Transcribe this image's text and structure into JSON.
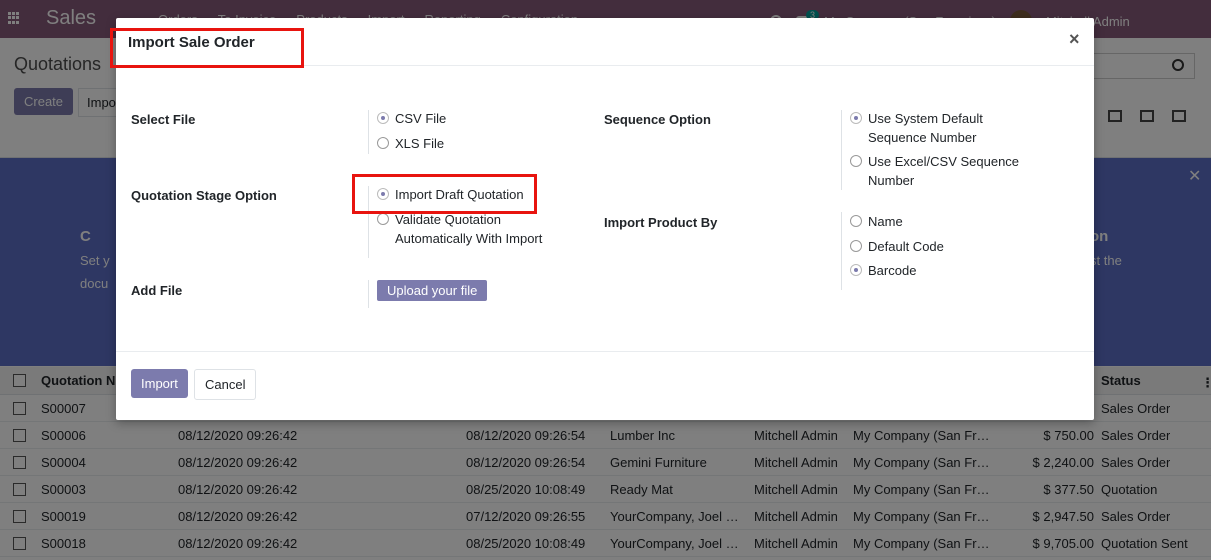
{
  "app": {
    "name": "Sales",
    "menu": [
      "Orders",
      "To Invoice",
      "Products",
      "Import",
      "Reporting",
      "Configuration"
    ],
    "chat_count": "3",
    "company": "My Company (San Francisco)",
    "user": "Mitchell Admin"
  },
  "control": {
    "breadcrumb": "Quotations",
    "create_label": "Create",
    "import_label": "Impo"
  },
  "helper": {
    "left_title": "C",
    "left_desc1": "Set y",
    "left_desc2": "docu",
    "right_title": "on",
    "right_desc": "st the"
  },
  "table": {
    "headers": {
      "number": "Quotation N",
      "status": "Status"
    },
    "rows": [
      {
        "number": "S00007",
        "date": "",
        "expected": "",
        "customer": "",
        "salesperson": "",
        "company": "",
        "total": "",
        "status": "Sales Order"
      },
      {
        "number": "S00006",
        "date": "08/12/2020 09:26:42",
        "expected": "08/12/2020 09:26:54",
        "customer": "Lumber Inc",
        "salesperson": "Mitchell Admin",
        "company": "My Company (San Fr…",
        "total": "$ 750.00",
        "status": "Sales Order"
      },
      {
        "number": "S00004",
        "date": "08/12/2020 09:26:42",
        "expected": "08/12/2020 09:26:54",
        "customer": "Gemini Furniture",
        "salesperson": "Mitchell Admin",
        "company": "My Company (San Fr…",
        "total": "$ 2,240.00",
        "status": "Sales Order"
      },
      {
        "number": "S00003",
        "date": "08/12/2020 09:26:42",
        "expected": "08/25/2020 10:08:49",
        "customer": "Ready Mat",
        "salesperson": "Mitchell Admin",
        "company": "My Company (San Fr…",
        "total": "$ 377.50",
        "status": "Quotation"
      },
      {
        "number": "S00019",
        "date": "08/12/2020 09:26:42",
        "expected": "07/12/2020 09:26:55",
        "customer": "YourCompany, Joel …",
        "salesperson": "Mitchell Admin",
        "company": "My Company (San Fr…",
        "total": "$ 2,947.50",
        "status": "Sales Order"
      },
      {
        "number": "S00018",
        "date": "08/12/2020 09:26:42",
        "expected": "08/25/2020 10:08:49",
        "customer": "YourCompany, Joel …",
        "salesperson": "Mitchell Admin",
        "company": "My Company (San Fr…",
        "total": "$ 9,705.00",
        "status": "Quotation Sent"
      }
    ]
  },
  "modal": {
    "title": "Import Sale Order",
    "close": "×",
    "select_file": {
      "label": "Select File",
      "options": [
        "CSV File",
        "XLS File"
      ],
      "selected": 0
    },
    "stage_option": {
      "label": "Quotation Stage Option",
      "options": [
        "Import Draft Quotation",
        "Validate Quotation Automatically With Import"
      ],
      "selected": 0
    },
    "add_file": {
      "label": "Add File",
      "button": "Upload your file"
    },
    "sequence_option": {
      "label": "Sequence Option",
      "options": [
        "Use System Default Sequence Number",
        "Use Excel/CSV Sequence Number"
      ],
      "selected": 0
    },
    "product_by": {
      "label": "Import Product By",
      "options": [
        "Name",
        "Default Code",
        "Barcode"
      ],
      "selected": 2
    },
    "footer": {
      "import_label": "Import",
      "cancel_label": "Cancel"
    }
  },
  "colors": {
    "brand": "#875a7b",
    "primary": "#7c7bad",
    "highlight": "#e8140f"
  }
}
